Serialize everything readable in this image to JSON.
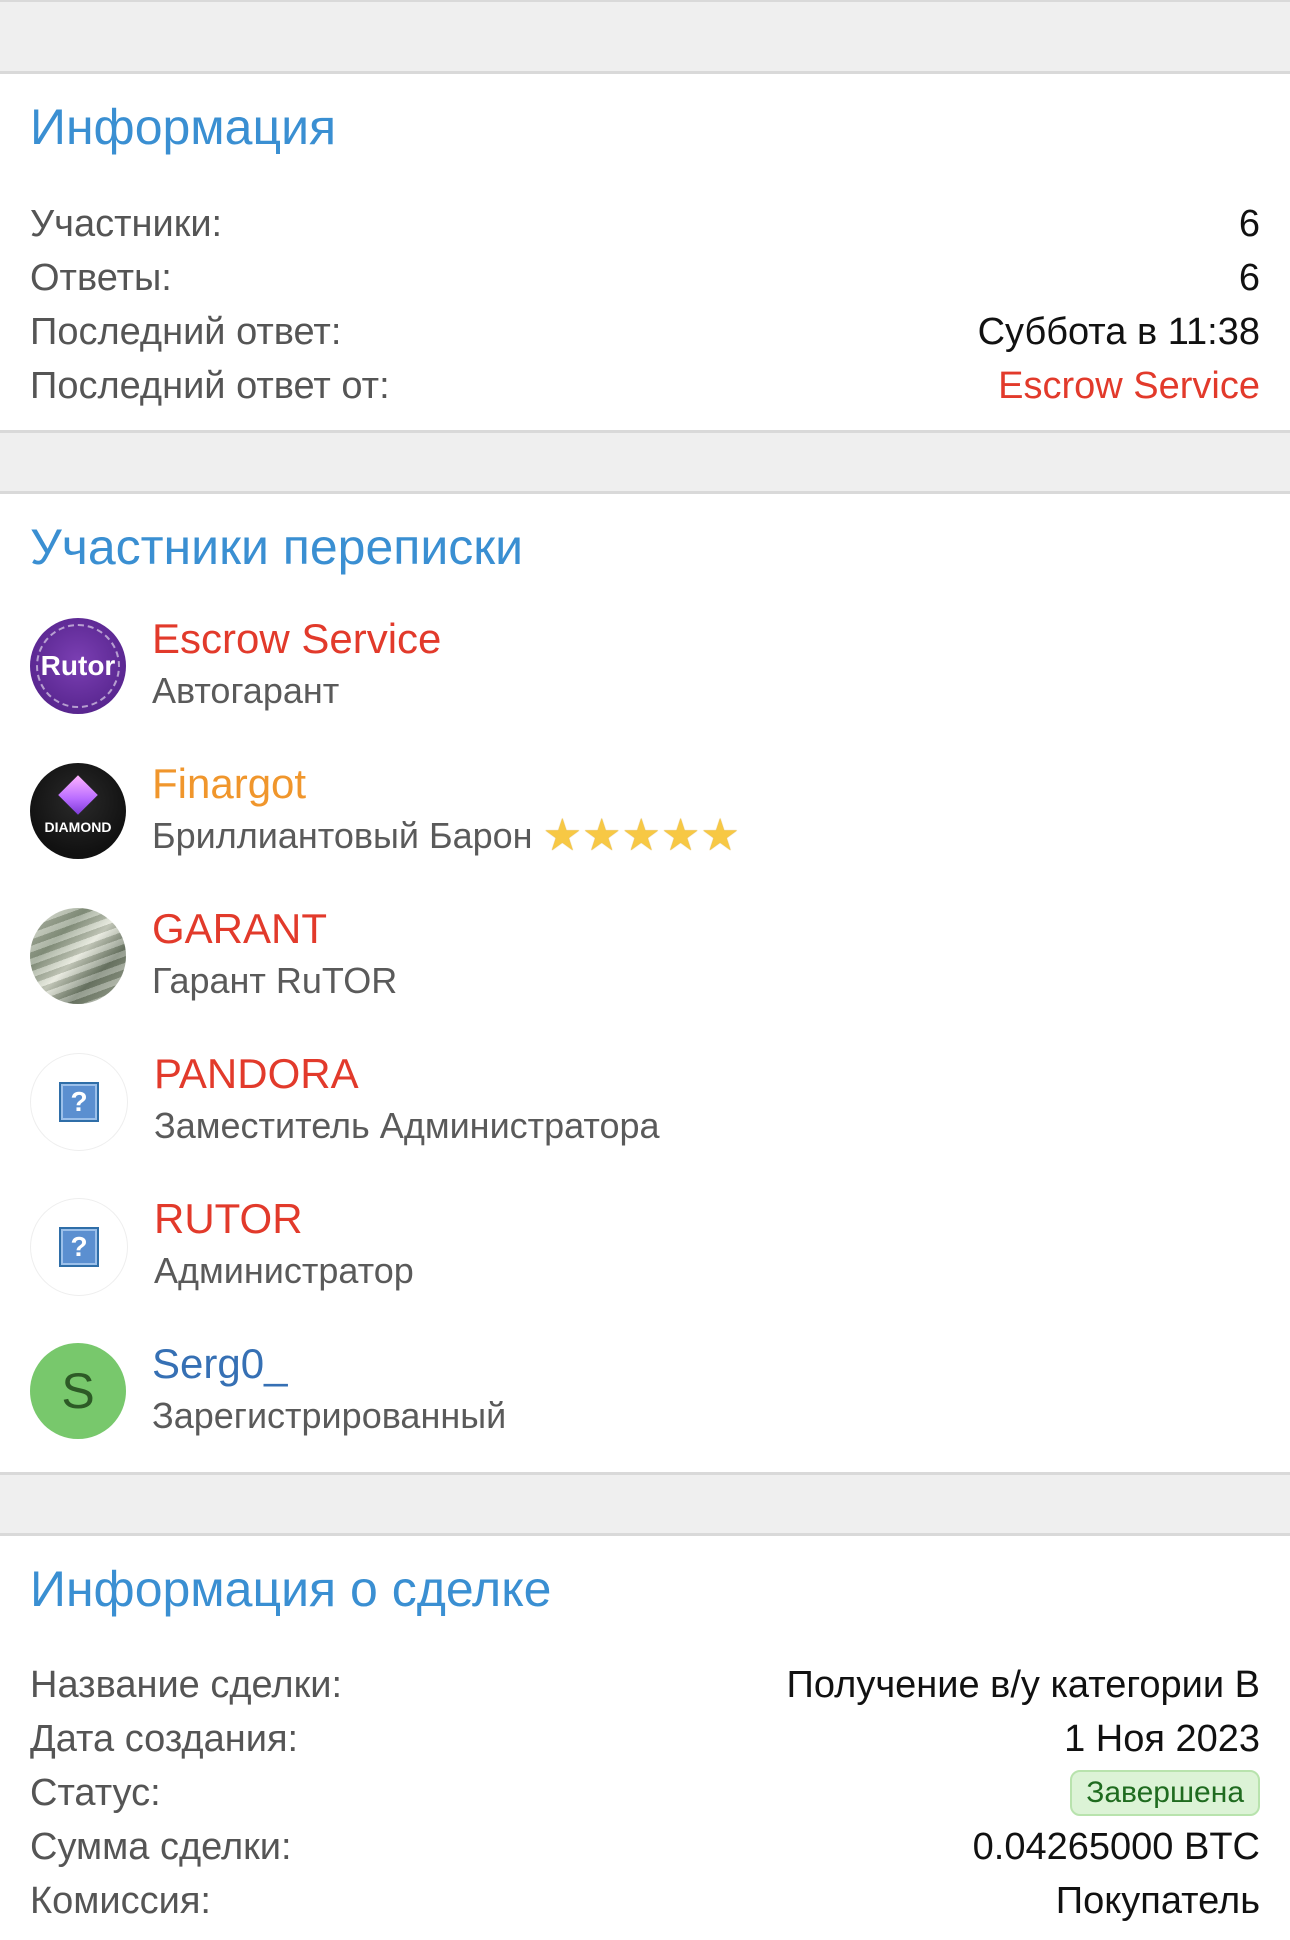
{
  "info": {
    "title": "Информация",
    "rows": [
      {
        "label": "Участники:",
        "value": "6"
      },
      {
        "label": "Ответы:",
        "value": "6"
      },
      {
        "label": "Последний ответ:",
        "value": "Суббота в 11:38"
      },
      {
        "label": "Последний ответ от:",
        "value": "Escrow Service"
      }
    ]
  },
  "participants": {
    "title": "Участники переписки",
    "items": [
      {
        "name": "Escrow Service",
        "role": "Автогарант",
        "avatar_text": "Rutor"
      },
      {
        "name": "Finargot",
        "role": "Бриллиантовый Барон",
        "avatar_text": "DIAMOND",
        "stars": "★★★★★"
      },
      {
        "name": "GARANT",
        "role": "Гарант RuTOR"
      },
      {
        "name": "PANDORA",
        "role": "Заместитель Администратора",
        "avatar_text": "?"
      },
      {
        "name": "RUTOR",
        "role": "Администратор",
        "avatar_text": "?"
      },
      {
        "name": "Serg0_",
        "role": "Зарегистрированный",
        "avatar_text": "S"
      }
    ]
  },
  "deal": {
    "title": "Информация о сделке",
    "rows": [
      {
        "label": "Название сделки:",
        "value": "Получение в/у категории B"
      },
      {
        "label": "Дата создания:",
        "value": "1 Ноя 2023"
      },
      {
        "label": "Статус:",
        "value": "Завершена"
      },
      {
        "label": "Сумма сделки:",
        "value": "0.04265000 BTC"
      },
      {
        "label": "Комиссия:",
        "value": "Покупатель"
      }
    ]
  },
  "colors": {
    "accent": "#3a8fd2",
    "red": "#e23a2b",
    "orange": "#f0962c",
    "blue_name": "#3670b4",
    "status_bg": "#dcf3d6"
  }
}
